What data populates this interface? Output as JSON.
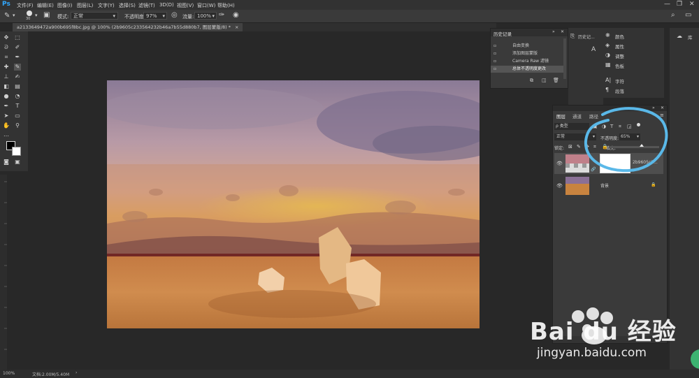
{
  "app": {
    "logo": "Ps"
  },
  "menu": [
    "文件(F)",
    "编辑(E)",
    "图像(I)",
    "图层(L)",
    "文字(Y)",
    "选择(S)",
    "滤镜(T)",
    "3D(D)",
    "视图(V)",
    "窗口(W)",
    "帮助(H)"
  ],
  "window_controls": [
    "—",
    "❐",
    "✕"
  ],
  "options": {
    "brush_size": "30",
    "mode_label": "模式:",
    "mode_value": "正常",
    "opacity_label": "不透明度:",
    "opacity_value": "97%",
    "flow_label": "流量:",
    "flow_value": "100%"
  },
  "document_tab": {
    "title": "a2133649472a900b695f8bc.jpg @ 100% (2b9605c233564232b46a7b55d880b7, 图层蒙版/8) *",
    "close": "×"
  },
  "history": {
    "title": "历史记录",
    "items": [
      "自由变换",
      "添加图层蒙版",
      "Camera Raw 滤镜",
      "总体不透明度更改"
    ],
    "active_index": 3
  },
  "mini_dock": {
    "history_btn": "历史记..."
  },
  "adjust_dock": {
    "items": [
      "颜色",
      "属性",
      "调整",
      "色板"
    ],
    "items2": [
      "字符",
      "段落"
    ]
  },
  "right_dock": {
    "library_label": "库"
  },
  "layers": {
    "tabs": [
      "图层",
      "通道",
      "路径"
    ],
    "filter_label": "ρ 类型",
    "blend_mode": "正常",
    "opacity_label": "不透明度:",
    "opacity_value": "65%",
    "opacity_fraction": 0.65,
    "lock_label": "锁定:",
    "fill_label": "填充:",
    "rows": [
      {
        "name": "2b9605c2...",
        "visible": true,
        "locked": false
      },
      {
        "name": "背景",
        "visible": true,
        "locked": true
      }
    ]
  },
  "status": {
    "zoom": "100%",
    "doc_info": "文档:2.00M/5.40M",
    "arrow": "›"
  },
  "watermark": {
    "brand": "Bai du 经验",
    "url": "jingyan.baidu.com"
  },
  "colors": {
    "annotation": "#5ab8e8",
    "accent": "#31a8ff"
  }
}
